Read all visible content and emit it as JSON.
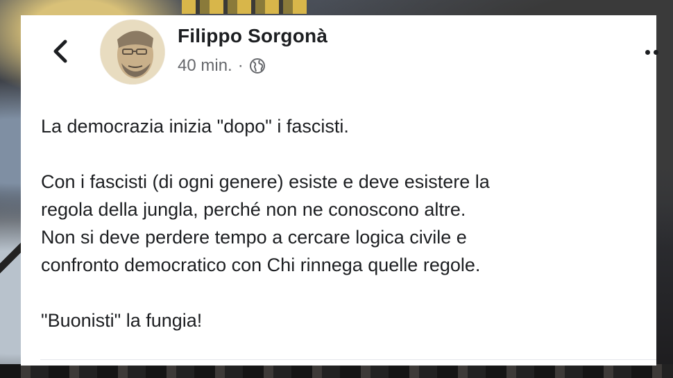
{
  "post": {
    "author_name": "Filippo Sorgonà",
    "timestamp": "40 min.",
    "separator": "·",
    "privacy_icon": "globe-icon",
    "back_icon": "chevron-left-icon",
    "more_icon": "more-options-icon",
    "paragraphs": [
      {
        "lines": [
          "La democrazia inizia \"dopo\" i fascisti."
        ]
      },
      {
        "lines": [
          "Con i fascisti (di ogni genere) esiste e deve esistere la",
          "regola della jungla, perché non ne conoscono altre.",
          "Non si deve perdere tempo a cercare logica civile e",
          "confronto democratico con Chi rinnega quelle regole."
        ]
      },
      {
        "lines": [
          "\"Buonisti\" la fungia!"
        ]
      }
    ]
  },
  "colors": {
    "card_background": "#ffffff",
    "primary_text": "#1c1e21",
    "secondary_text": "#65676b"
  }
}
